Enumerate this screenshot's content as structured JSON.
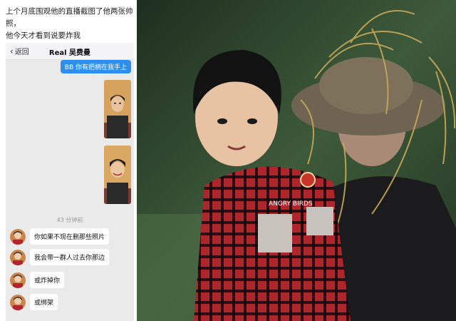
{
  "caption": {
    "line1": "上个月底围观他的直播截图了他两张帅照，",
    "line2": "他今天才看到说要炸我"
  },
  "chat": {
    "back_label": "返回",
    "title": "Real 吴费曼",
    "outgoing_text": "BB 你有把柄在我手上",
    "timestamp": "43 分钟前",
    "messages": [
      {
        "text": "你如果不现在删那些照片"
      },
      {
        "text": "我会带一群人过去你那边"
      },
      {
        "text": "或炸掉你"
      },
      {
        "text": "或绑架"
      }
    ]
  },
  "photo": {
    "badge_text": "ANGRY BIRDS",
    "colors": {
      "shirt_red": "#b0242c",
      "background_green": "#3d5a3a",
      "hat_straw": "#c7a85a"
    }
  },
  "colors": {
    "outgoing_bubble": "#2c8ff0",
    "chat_bg": "#eaeaea",
    "navbar_bg": "#f4f4f6"
  }
}
